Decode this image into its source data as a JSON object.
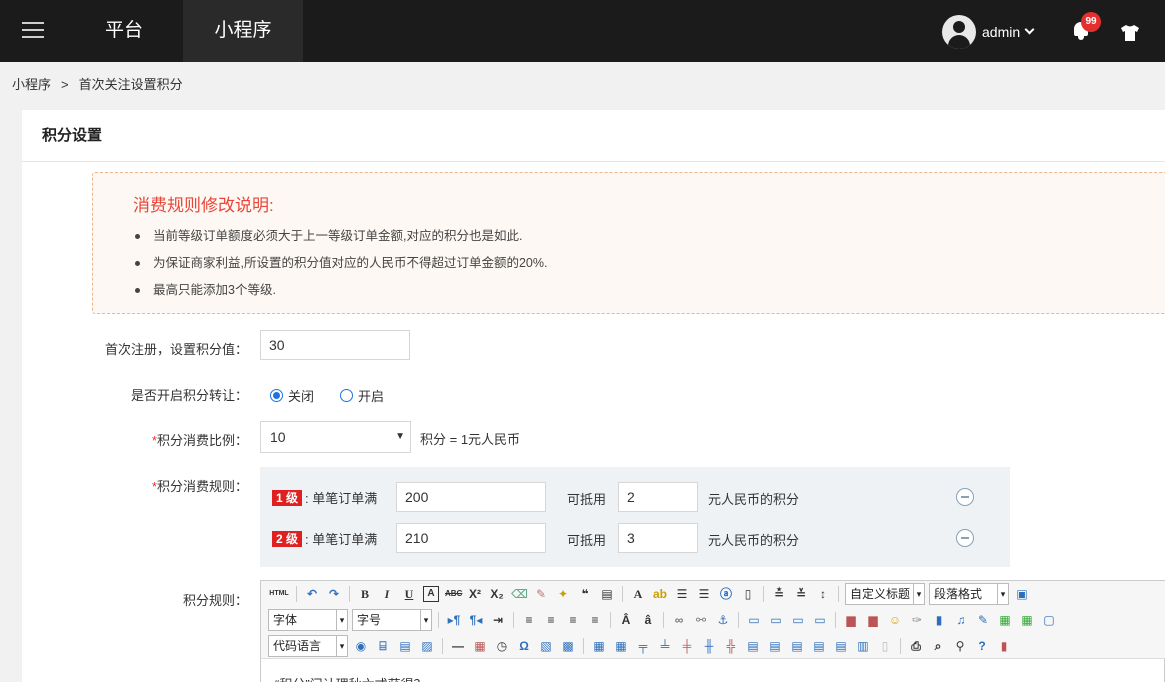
{
  "topbar": {
    "nav": [
      "平台",
      "小程序"
    ],
    "user": "admin",
    "notification_count": "99"
  },
  "breadcrumb": {
    "root": "小程序",
    "sep": ">",
    "current": "首次关注设置积分"
  },
  "panel": {
    "title": "积分设置"
  },
  "notice": {
    "title": "消费规则修改说明:",
    "items": [
      "当前等级订单额度必须大于上一等级订单金额,对应的积分也是如此.",
      "为保证商家利益,所设置的积分值对应的人民币不得超过订单金额的20%.",
      "最高只能添加3个等级."
    ]
  },
  "form": {
    "register_label": "首次注册，设置积分值：",
    "register_value": "30",
    "transfer_label": "是否开启积分转让：",
    "transfer_off": "关闭",
    "transfer_on": "开启",
    "ratio_star": "*",
    "ratio_label": "积分消费比例：",
    "ratio_value": "10",
    "ratio_unit": "积分 = 1元人民币",
    "rules_star": "*",
    "rules_label": "积分消费规则：",
    "rules": [
      {
        "level": "1 级",
        "prefix": ": 单笔订单满",
        "amount": "200",
        "mid": "可抵用",
        "points": "2",
        "suffix": "元人民币的积分"
      },
      {
        "level": "2 级",
        "prefix": ": 单笔订单满",
        "amount": "210",
        "mid": "可抵用",
        "points": "3",
        "suffix": "元人民币的积分"
      }
    ],
    "points_rule_label": "积分规则："
  },
  "editor": {
    "html_btn": "HTML",
    "title_select": "自定义标题",
    "paragraph_select": "段落格式",
    "font_select": "字体",
    "size_select": "字号",
    "code_select": "代码语言",
    "body_preview": "“积分”门计理秋六式获得？"
  }
}
